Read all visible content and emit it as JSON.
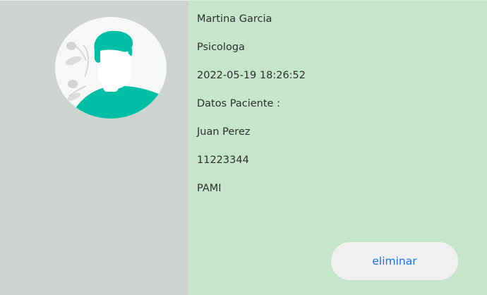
{
  "professional": {
    "name": "Martina Garcia",
    "specialty": "Psicologa",
    "datetime": "2022-05-19 18:26:52"
  },
  "patient": {
    "section_label": "Datos Paciente :",
    "name": "Juan Perez",
    "document_number": "11223344",
    "insurance": "PAMI"
  },
  "actions": {
    "delete_label": "eliminar"
  },
  "colors": {
    "left_panel_bg": "#cfd3cf",
    "right_panel_bg": "#c5e6cb",
    "avatar_accent": "#00bfa6",
    "button_text": "#1a73e8"
  },
  "icons": {
    "avatar": "user-avatar-illustration"
  }
}
